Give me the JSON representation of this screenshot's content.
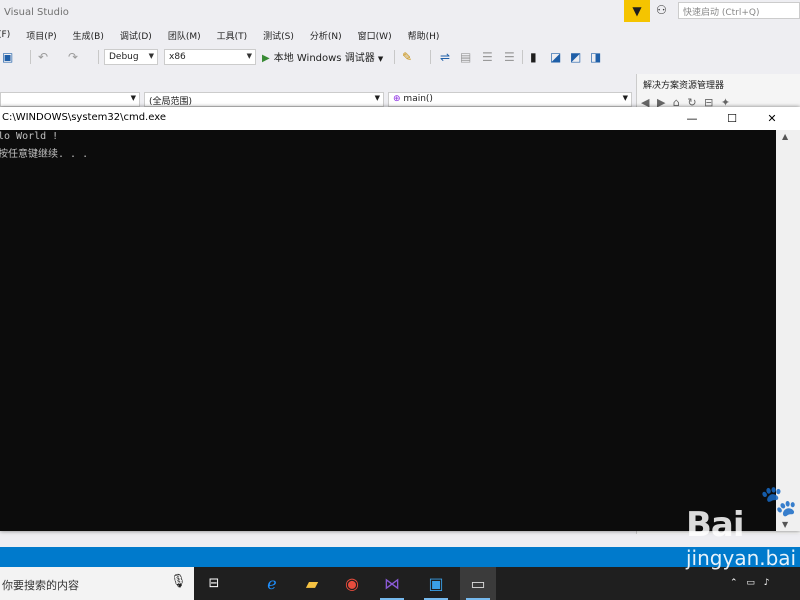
{
  "vs": {
    "title": "Visual Studio",
    "quick_launch_placeholder": "快速启动 (Ctrl+Q)",
    "menu": [
      {
        "label": "(F)"
      },
      {
        "label": "项目(P)"
      },
      {
        "label": "生成(B)"
      },
      {
        "label": "调试(D)"
      },
      {
        "label": "团队(M)"
      },
      {
        "label": "工具(T)"
      },
      {
        "label": "测试(S)"
      },
      {
        "label": "分析(N)"
      },
      {
        "label": "窗口(W)"
      },
      {
        "label": "帮助(H)"
      }
    ],
    "toolbar": {
      "config": "Debug",
      "platform": "x86",
      "run_label": "本地 Windows 调试器"
    },
    "navbar": {
      "scope": "(全局范围)",
      "member": "main()"
    },
    "solution_explorer_title": "解决方案资源管理器"
  },
  "console": {
    "title": "C:\\WINDOWS\\system32\\cmd.exe",
    "lines": [
      "lo World !",
      "按任意键继续. . ."
    ]
  },
  "taskbar": {
    "search_placeholder": "你要搜索的内容"
  },
  "watermark": {
    "brand": "Bai",
    "site": "jingyan.bai"
  },
  "colors": {
    "vs_accent": "#007acc",
    "console_bg": "#0c0c0c",
    "filter_yellow": "#f5c400"
  }
}
